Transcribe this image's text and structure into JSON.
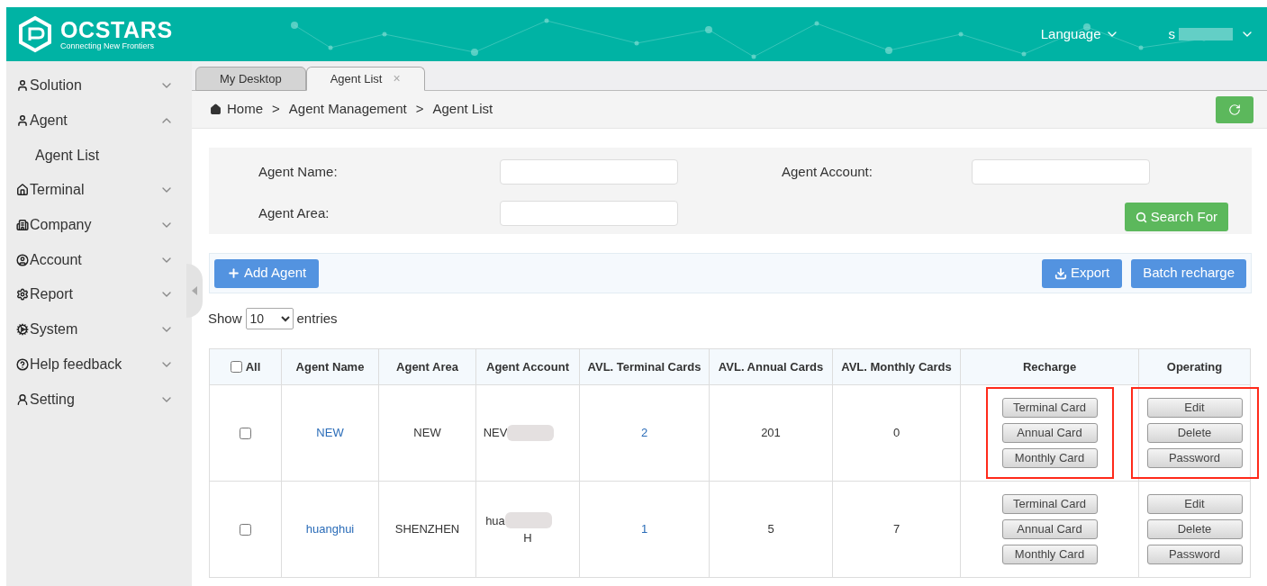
{
  "header": {
    "logo": "OCSTARS",
    "tagline": "Connecting New Frontiers",
    "language": "Language",
    "user": "s"
  },
  "sidebar": {
    "items": [
      {
        "label": "Solution",
        "expanded": false
      },
      {
        "label": "Agent",
        "expanded": true,
        "children": [
          {
            "label": "Agent List"
          }
        ]
      },
      {
        "label": "Terminal",
        "expanded": false
      },
      {
        "label": "Company",
        "expanded": false
      },
      {
        "label": "Account",
        "expanded": false
      },
      {
        "label": "Report",
        "expanded": false
      },
      {
        "label": "System",
        "expanded": false
      },
      {
        "label": "Help feedback",
        "expanded": false
      },
      {
        "label": "Setting",
        "expanded": false
      }
    ]
  },
  "tabs": [
    {
      "label": "My Desktop",
      "selected": false
    },
    {
      "label": "Agent List",
      "selected": true,
      "close": "×"
    }
  ],
  "breadcrumb": [
    "Home",
    ">",
    "Agent Management",
    ">",
    "Agent List"
  ],
  "search": {
    "fields": [
      {
        "label": "Agent Name:"
      },
      {
        "label": "Agent Account:"
      },
      {
        "label": "Agent Area:"
      }
    ],
    "button": "Search For"
  },
  "toolbar": {
    "add": "Add Agent",
    "export": "Export",
    "batch": "Batch recharge"
  },
  "entries": {
    "show": "Show",
    "value": "10",
    "suffix": "entries"
  },
  "table": {
    "all_checked": false,
    "columns": [
      "All",
      "Agent Name",
      "Agent Area",
      "Agent Account",
      "AVL. Terminal Cards",
      "AVL. Annual Cards",
      "AVL. Monthly Cards",
      "Recharge",
      "Operating"
    ],
    "rows": [
      {
        "checked": false,
        "name": "NEW",
        "area": "NEW",
        "account": [
          "NEV"
        ],
        "terminal": "2",
        "annual": "201",
        "monthly": "0",
        "recharge": [
          "Terminal Card",
          "Annual Card",
          "Monthly Card"
        ],
        "operating": [
          "Edit",
          "Delete",
          "Password"
        ],
        "highlighted": true
      },
      {
        "checked": false,
        "name": "huanghui",
        "area": "SHENZHEN",
        "account": [
          "hua",
          "H"
        ],
        "terminal": "1",
        "annual": "5",
        "monthly": "7",
        "recharge": [
          "Terminal Card",
          "Annual Card",
          "Monthly Card"
        ],
        "operating": [
          "Edit",
          "Delete",
          "Password"
        ],
        "highlighted": false
      }
    ]
  }
}
